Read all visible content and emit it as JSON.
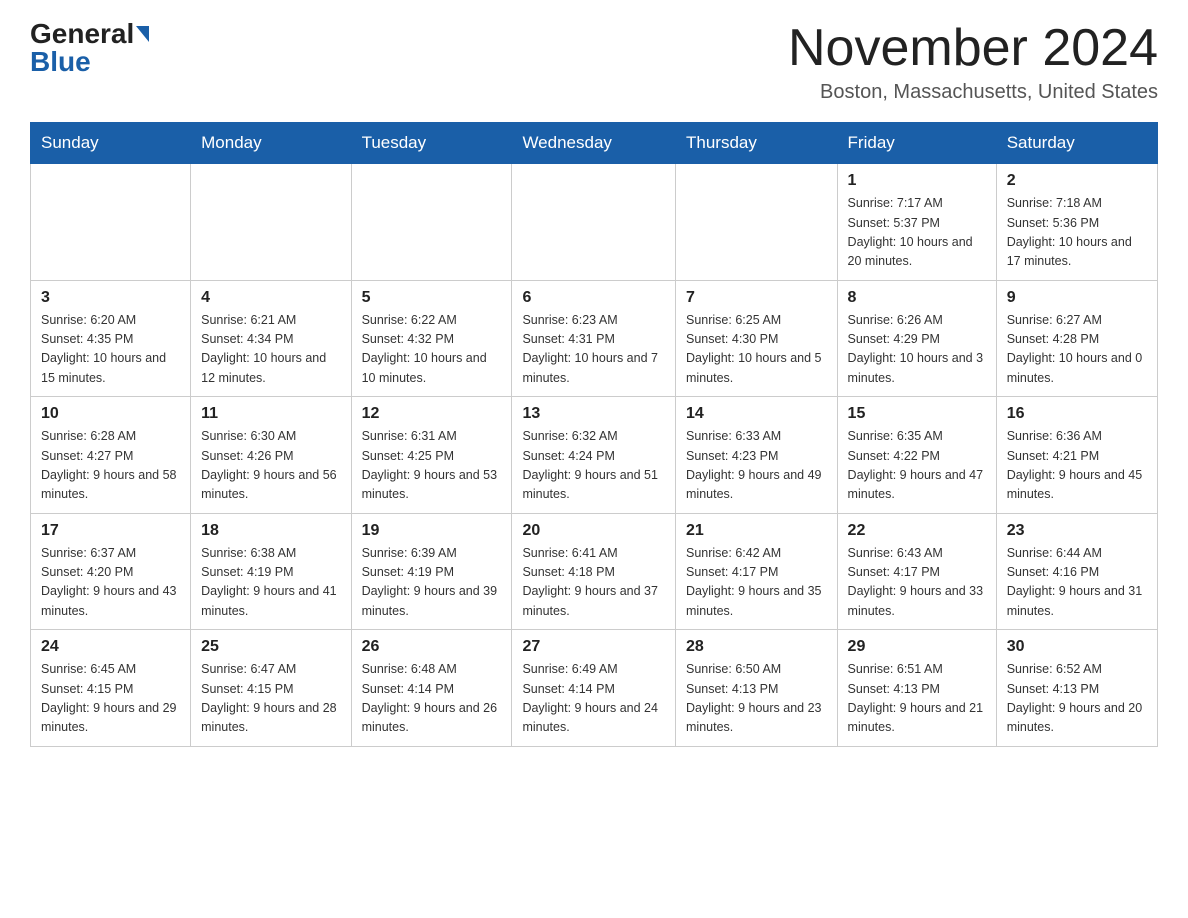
{
  "logo": {
    "general": "General",
    "blue": "Blue"
  },
  "header": {
    "month": "November 2024",
    "location": "Boston, Massachusetts, United States"
  },
  "weekdays": [
    "Sunday",
    "Monday",
    "Tuesday",
    "Wednesday",
    "Thursday",
    "Friday",
    "Saturday"
  ],
  "weeks": [
    [
      {
        "day": "",
        "sunrise": "",
        "sunset": "",
        "daylight": ""
      },
      {
        "day": "",
        "sunrise": "",
        "sunset": "",
        "daylight": ""
      },
      {
        "day": "",
        "sunrise": "",
        "sunset": "",
        "daylight": ""
      },
      {
        "day": "",
        "sunrise": "",
        "sunset": "",
        "daylight": ""
      },
      {
        "day": "",
        "sunrise": "",
        "sunset": "",
        "daylight": ""
      },
      {
        "day": "1",
        "sunrise": "Sunrise: 7:17 AM",
        "sunset": "Sunset: 5:37 PM",
        "daylight": "Daylight: 10 hours and 20 minutes."
      },
      {
        "day": "2",
        "sunrise": "Sunrise: 7:18 AM",
        "sunset": "Sunset: 5:36 PM",
        "daylight": "Daylight: 10 hours and 17 minutes."
      }
    ],
    [
      {
        "day": "3",
        "sunrise": "Sunrise: 6:20 AM",
        "sunset": "Sunset: 4:35 PM",
        "daylight": "Daylight: 10 hours and 15 minutes."
      },
      {
        "day": "4",
        "sunrise": "Sunrise: 6:21 AM",
        "sunset": "Sunset: 4:34 PM",
        "daylight": "Daylight: 10 hours and 12 minutes."
      },
      {
        "day": "5",
        "sunrise": "Sunrise: 6:22 AM",
        "sunset": "Sunset: 4:32 PM",
        "daylight": "Daylight: 10 hours and 10 minutes."
      },
      {
        "day": "6",
        "sunrise": "Sunrise: 6:23 AM",
        "sunset": "Sunset: 4:31 PM",
        "daylight": "Daylight: 10 hours and 7 minutes."
      },
      {
        "day": "7",
        "sunrise": "Sunrise: 6:25 AM",
        "sunset": "Sunset: 4:30 PM",
        "daylight": "Daylight: 10 hours and 5 minutes."
      },
      {
        "day": "8",
        "sunrise": "Sunrise: 6:26 AM",
        "sunset": "Sunset: 4:29 PM",
        "daylight": "Daylight: 10 hours and 3 minutes."
      },
      {
        "day": "9",
        "sunrise": "Sunrise: 6:27 AM",
        "sunset": "Sunset: 4:28 PM",
        "daylight": "Daylight: 10 hours and 0 minutes."
      }
    ],
    [
      {
        "day": "10",
        "sunrise": "Sunrise: 6:28 AM",
        "sunset": "Sunset: 4:27 PM",
        "daylight": "Daylight: 9 hours and 58 minutes."
      },
      {
        "day": "11",
        "sunrise": "Sunrise: 6:30 AM",
        "sunset": "Sunset: 4:26 PM",
        "daylight": "Daylight: 9 hours and 56 minutes."
      },
      {
        "day": "12",
        "sunrise": "Sunrise: 6:31 AM",
        "sunset": "Sunset: 4:25 PM",
        "daylight": "Daylight: 9 hours and 53 minutes."
      },
      {
        "day": "13",
        "sunrise": "Sunrise: 6:32 AM",
        "sunset": "Sunset: 4:24 PM",
        "daylight": "Daylight: 9 hours and 51 minutes."
      },
      {
        "day": "14",
        "sunrise": "Sunrise: 6:33 AM",
        "sunset": "Sunset: 4:23 PM",
        "daylight": "Daylight: 9 hours and 49 minutes."
      },
      {
        "day": "15",
        "sunrise": "Sunrise: 6:35 AM",
        "sunset": "Sunset: 4:22 PM",
        "daylight": "Daylight: 9 hours and 47 minutes."
      },
      {
        "day": "16",
        "sunrise": "Sunrise: 6:36 AM",
        "sunset": "Sunset: 4:21 PM",
        "daylight": "Daylight: 9 hours and 45 minutes."
      }
    ],
    [
      {
        "day": "17",
        "sunrise": "Sunrise: 6:37 AM",
        "sunset": "Sunset: 4:20 PM",
        "daylight": "Daylight: 9 hours and 43 minutes."
      },
      {
        "day": "18",
        "sunrise": "Sunrise: 6:38 AM",
        "sunset": "Sunset: 4:19 PM",
        "daylight": "Daylight: 9 hours and 41 minutes."
      },
      {
        "day": "19",
        "sunrise": "Sunrise: 6:39 AM",
        "sunset": "Sunset: 4:19 PM",
        "daylight": "Daylight: 9 hours and 39 minutes."
      },
      {
        "day": "20",
        "sunrise": "Sunrise: 6:41 AM",
        "sunset": "Sunset: 4:18 PM",
        "daylight": "Daylight: 9 hours and 37 minutes."
      },
      {
        "day": "21",
        "sunrise": "Sunrise: 6:42 AM",
        "sunset": "Sunset: 4:17 PM",
        "daylight": "Daylight: 9 hours and 35 minutes."
      },
      {
        "day": "22",
        "sunrise": "Sunrise: 6:43 AM",
        "sunset": "Sunset: 4:17 PM",
        "daylight": "Daylight: 9 hours and 33 minutes."
      },
      {
        "day": "23",
        "sunrise": "Sunrise: 6:44 AM",
        "sunset": "Sunset: 4:16 PM",
        "daylight": "Daylight: 9 hours and 31 minutes."
      }
    ],
    [
      {
        "day": "24",
        "sunrise": "Sunrise: 6:45 AM",
        "sunset": "Sunset: 4:15 PM",
        "daylight": "Daylight: 9 hours and 29 minutes."
      },
      {
        "day": "25",
        "sunrise": "Sunrise: 6:47 AM",
        "sunset": "Sunset: 4:15 PM",
        "daylight": "Daylight: 9 hours and 28 minutes."
      },
      {
        "day": "26",
        "sunrise": "Sunrise: 6:48 AM",
        "sunset": "Sunset: 4:14 PM",
        "daylight": "Daylight: 9 hours and 26 minutes."
      },
      {
        "day": "27",
        "sunrise": "Sunrise: 6:49 AM",
        "sunset": "Sunset: 4:14 PM",
        "daylight": "Daylight: 9 hours and 24 minutes."
      },
      {
        "day": "28",
        "sunrise": "Sunrise: 6:50 AM",
        "sunset": "Sunset: 4:13 PM",
        "daylight": "Daylight: 9 hours and 23 minutes."
      },
      {
        "day": "29",
        "sunrise": "Sunrise: 6:51 AM",
        "sunset": "Sunset: 4:13 PM",
        "daylight": "Daylight: 9 hours and 21 minutes."
      },
      {
        "day": "30",
        "sunrise": "Sunrise: 6:52 AM",
        "sunset": "Sunset: 4:13 PM",
        "daylight": "Daylight: 9 hours and 20 minutes."
      }
    ]
  ]
}
